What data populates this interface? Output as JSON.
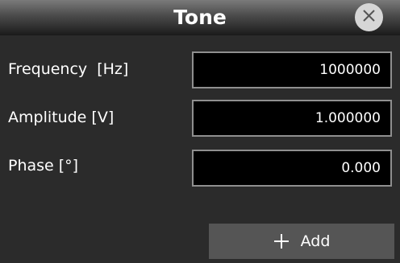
{
  "dialog": {
    "title": "Tone",
    "close_icon": "close-icon"
  },
  "fields": [
    {
      "label": "Frequency  [Hz]",
      "value": "1000000"
    },
    {
      "label": "Amplitude [V]",
      "value": "1.000000"
    },
    {
      "label": "Phase [°]",
      "value": "0.000"
    }
  ],
  "add_button": {
    "label": "Add",
    "icon": "plus-icon"
  },
  "colors": {
    "background": "#2b2b2b",
    "field_background": "#000000",
    "field_border": "#8f8f8f",
    "button_background": "#555555",
    "close_button": "#d6d6d6",
    "text": "#ffffff"
  }
}
